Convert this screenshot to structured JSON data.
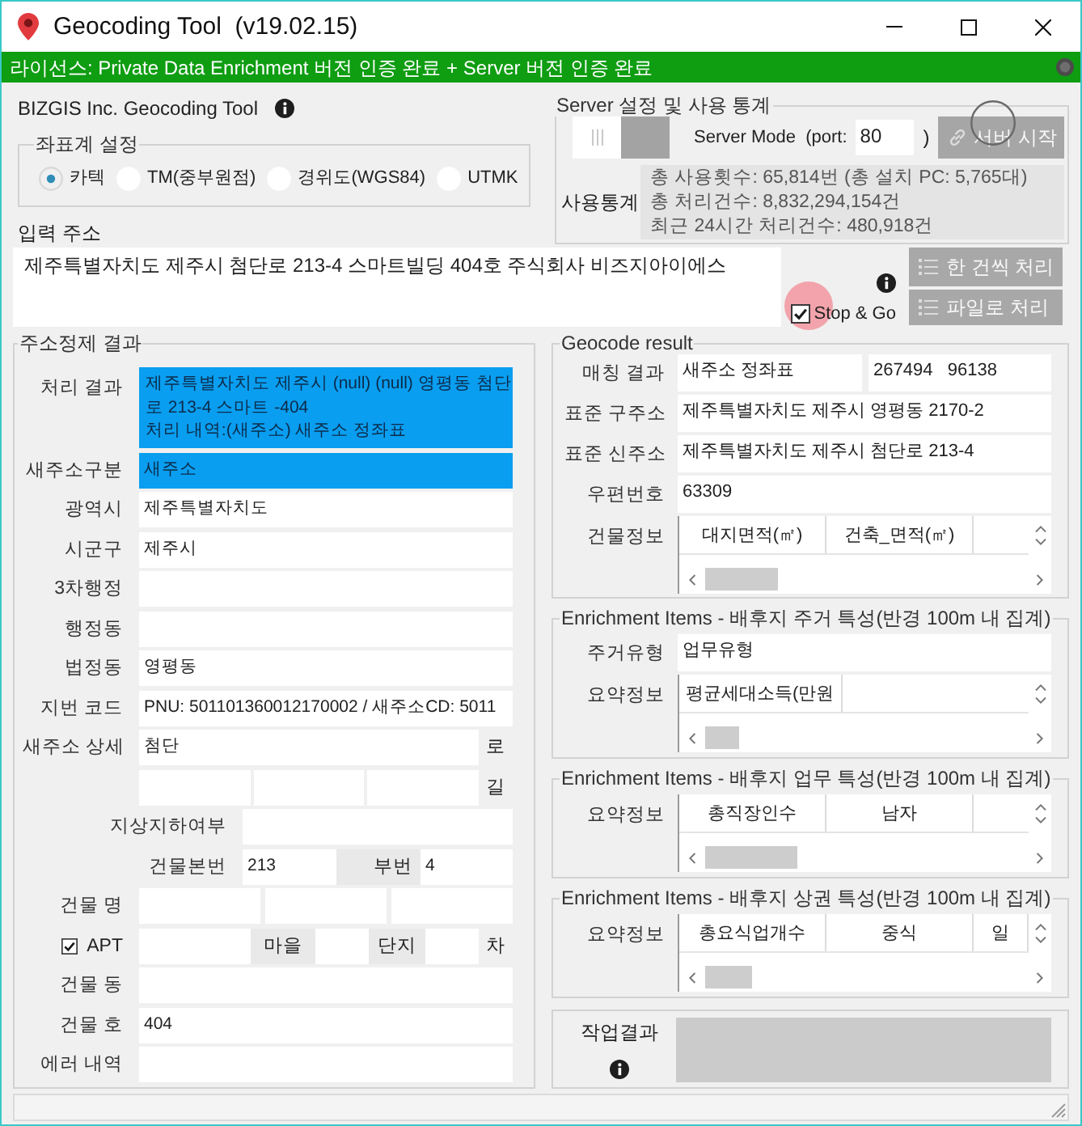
{
  "window": {
    "title": "Geocoding Tool  (v19.02.15)"
  },
  "license_bar": {
    "text": "라이선스: Private Data Enrichment 버전 인증 완료 + Server 버전 인증 완료"
  },
  "app_heading": "BIZGIS Inc. Geocoding Tool",
  "coordinate_system": {
    "title": "좌표계 설정",
    "options": [
      {
        "label": "카텍",
        "selected": true
      },
      {
        "label": "TM(중부원점)",
        "selected": false
      },
      {
        "label": "경위도(WGS84)",
        "selected": false
      },
      {
        "label": "UTMK",
        "selected": false
      }
    ]
  },
  "input_address": {
    "label": "입력 주소",
    "value": "제주특별자치도 제주시 첨단로 213-4 스마트빌딩 404호 주식회사 비즈지아이에스"
  },
  "server": {
    "title": "Server 설정 및 사용 통계",
    "enabled": false,
    "mode_label": "Server Mode  (port:",
    "port": "80",
    "port_close": ")",
    "start_button": {
      "label": "서버 시작",
      "disabled": true
    },
    "stats_label": "사용통계",
    "stats": [
      "총 사용횟수: 65,814번 (총 설치 PC: 5,765대)",
      "총 처리건수: 8,832,294,154건",
      "최근 24시간 처리건수: 480,918건"
    ]
  },
  "actions": {
    "stop_go": {
      "label": "Stop & Go",
      "checked": true
    },
    "buttons": [
      {
        "label": "한 건씩 처리"
      },
      {
        "label": "파일로 처리"
      }
    ]
  },
  "refine_result": {
    "title": "주소정제 결과",
    "rows": [
      {
        "kind": "result",
        "label": "처리 결과",
        "highlighted": true,
        "lines": [
          "제주특별자치도 제주시 (null) (null) 영평동 첨단",
          "로 213-4 스마트 -404",
          "처리 내역:(새주소) 새주소 정좌표"
        ]
      },
      {
        "kind": "field",
        "label": "새주소구분",
        "value": "새주소",
        "highlighted": true
      },
      {
        "kind": "field",
        "label": "광역시",
        "value": "제주특별자치도",
        "highlighted": false
      },
      {
        "kind": "field",
        "label": "시군구",
        "value": "제주시",
        "highlighted": false
      },
      {
        "kind": "field",
        "label": "3차행정",
        "highlighted": false
      },
      {
        "kind": "field",
        "label": "행정동",
        "highlighted": false
      },
      {
        "kind": "field",
        "label": "법정동",
        "value": "영평동",
        "highlighted": false
      },
      {
        "kind": "field",
        "label": "지번 코드",
        "value": "PNU: 501101360012170002 / 새주소CD: 5011",
        "highlighted": false
      },
      {
        "kind": "suffixed",
        "label": "새주소 상세",
        "value": "첨단",
        "suffix": "로"
      },
      {
        "kind": "split",
        "suffix": "길"
      },
      {
        "kind": "wide_label",
        "label": "지상지하여부"
      },
      {
        "kind": "main_sub",
        "label": "건물본번",
        "value": "213",
        "sub_label": "부번",
        "sub_value": "4"
      },
      {
        "kind": "triple",
        "label": "건물 명"
      },
      {
        "kind": "apt",
        "label": "APT",
        "checked": true,
        "village_label": "마을",
        "complex_label": "단지",
        "suffix": "차"
      },
      {
        "kind": "field",
        "label": "건물 동",
        "highlighted": false
      },
      {
        "kind": "field",
        "label": "건물 호",
        "value": "404",
        "highlighted": false
      },
      {
        "kind": "field",
        "label": "에러 내역",
        "highlighted": false
      }
    ]
  },
  "geocode_result": {
    "title": "Geocode result",
    "rows": [
      {
        "kind": "pair",
        "label": "매칭 결과",
        "value": "새주소 정좌표",
        "value_2": "267494   96138"
      },
      {
        "kind": "field",
        "label": "표준 구주소",
        "value": "제주특별자치도 제주시 영평동 2170-2"
      },
      {
        "kind": "field",
        "label": "표준 신주소",
        "value": "제주특별자치도 제주시 첨단로 213-4"
      },
      {
        "kind": "field",
        "label": "우편번호",
        "value": "63309"
      },
      {
        "kind": "grid",
        "label": "건물정보",
        "columns": [
          "대지면적(㎡)",
          "건축_면적(㎡)"
        ]
      }
    ]
  },
  "enrichment": [
    {
      "title": "Enrichment Items - 배후지 주거 특성(반경 100m 내 집계)",
      "rows": [
        {
          "kind": "field",
          "label": "주거유형",
          "value": "업무유형"
        },
        {
          "kind": "grid",
          "label": "요약정보",
          "columns": [
            "평균세대소득(만원"
          ]
        }
      ]
    },
    {
      "title": "Enrichment Items - 배후지 업무 특성(반경 100m 내 집계)",
      "rows": [
        {
          "kind": "grid",
          "label": "요약정보",
          "columns": [
            "총직장인수",
            "남자"
          ]
        }
      ]
    },
    {
      "title": "Enrichment Items - 배후지 상권 특성(반경 100m 내 집계)",
      "rows": [
        {
          "kind": "grid",
          "label": "요약정보",
          "columns": [
            "총요식업개수",
            "중식",
            "일"
          ]
        }
      ]
    }
  ],
  "job_result": {
    "label": "작업결과"
  }
}
